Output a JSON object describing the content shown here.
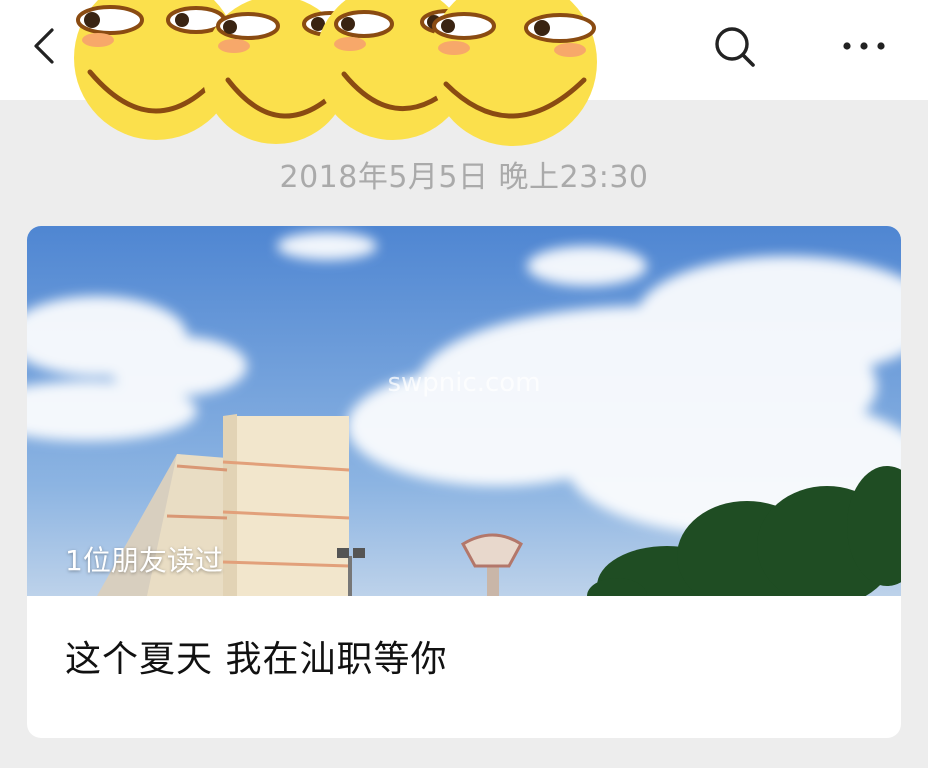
{
  "nav": {
    "back_icon": "chevron-left-icon",
    "search_icon": "search-icon",
    "more_icon": "more-dots-icon"
  },
  "timestamp": "2018年5月5日 晚上23:30",
  "article": {
    "read_count": "1位朋友读过",
    "watermark": "swpnic.com",
    "title": "这个夏天 我在汕职等你"
  },
  "colors": {
    "background": "#ededed",
    "card": "#ffffff",
    "timestamp_text": "#aaaaaa",
    "sticker_face": "#fbe04c",
    "sky": "#5b8fd6"
  }
}
